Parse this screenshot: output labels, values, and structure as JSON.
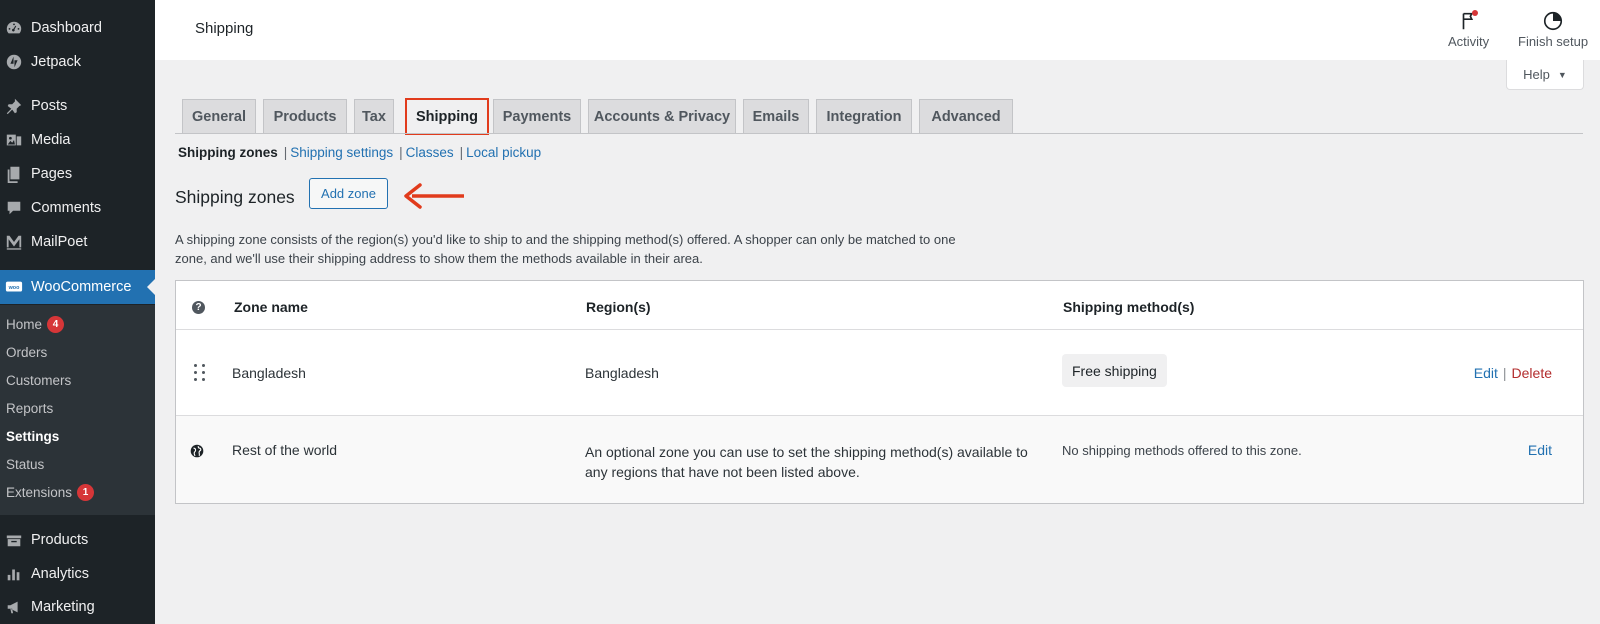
{
  "sidebar": {
    "items_top": [
      {
        "label": "Dashboard",
        "icon": "dashboard-icon"
      },
      {
        "label": "Jetpack",
        "icon": "jetpack-icon"
      },
      {
        "label": "Posts",
        "icon": "pin-icon"
      },
      {
        "label": "Media",
        "icon": "media-icon"
      },
      {
        "label": "Pages",
        "icon": "pages-icon"
      },
      {
        "label": "Comments",
        "icon": "comment-icon"
      },
      {
        "label": "MailPoet",
        "icon": "mailpoet-icon"
      },
      {
        "label": "WooCommerce",
        "icon": "woo-icon"
      }
    ],
    "woo_submenu": [
      {
        "label": "Home",
        "badge": "4"
      },
      {
        "label": "Orders"
      },
      {
        "label": "Customers"
      },
      {
        "label": "Reports"
      },
      {
        "label": "Settings"
      },
      {
        "label": "Status"
      },
      {
        "label": "Extensions",
        "badge": "1"
      }
    ],
    "items_bottom": [
      {
        "label": "Products",
        "icon": "products-icon"
      },
      {
        "label": "Analytics",
        "icon": "analytics-icon"
      },
      {
        "label": "Marketing",
        "icon": "megaphone-icon"
      }
    ]
  },
  "header": {
    "title": "Shipping",
    "activity_label": "Activity",
    "finish_setup_label": "Finish setup",
    "help_label": "Help"
  },
  "tabs": [
    {
      "label": "General"
    },
    {
      "label": "Products"
    },
    {
      "label": "Tax"
    },
    {
      "label": "Shipping"
    },
    {
      "label": "Payments"
    },
    {
      "label": "Accounts & Privacy"
    },
    {
      "label": "Emails"
    },
    {
      "label": "Integration"
    },
    {
      "label": "Advanced"
    }
  ],
  "subnav": {
    "current": "Shipping zones",
    "links": [
      "Shipping settings",
      "Classes",
      "Local pickup"
    ],
    "separator": "|"
  },
  "zones": {
    "heading": "Shipping zones",
    "add_button": "Add zone",
    "description": "A shipping zone consists of the region(s) you'd like to ship to and the shipping method(s) offered. A shopper can only be matched to one zone, and we'll use their shipping address to show them the methods available in their area.",
    "help_tip": "?",
    "columns": [
      "Zone name",
      "Region(s)",
      "Shipping method(s)"
    ],
    "rows": [
      {
        "name": "Bangladesh",
        "regions": "Bangladesh",
        "method": "Free shipping",
        "edit": "Edit",
        "delete": "Delete"
      },
      {
        "name": "Rest of the world",
        "regions": "An optional zone you can use to set the shipping method(s) available to any regions that have not been listed above.",
        "method": "No shipping methods offered to this zone.",
        "edit": "Edit"
      }
    ]
  },
  "colors": {
    "sidebar_bg": "#1d2327",
    "accent": "#2271b1",
    "highlight": "#e13b1c",
    "badge": "#d63638",
    "delete": "#b32d2e"
  }
}
